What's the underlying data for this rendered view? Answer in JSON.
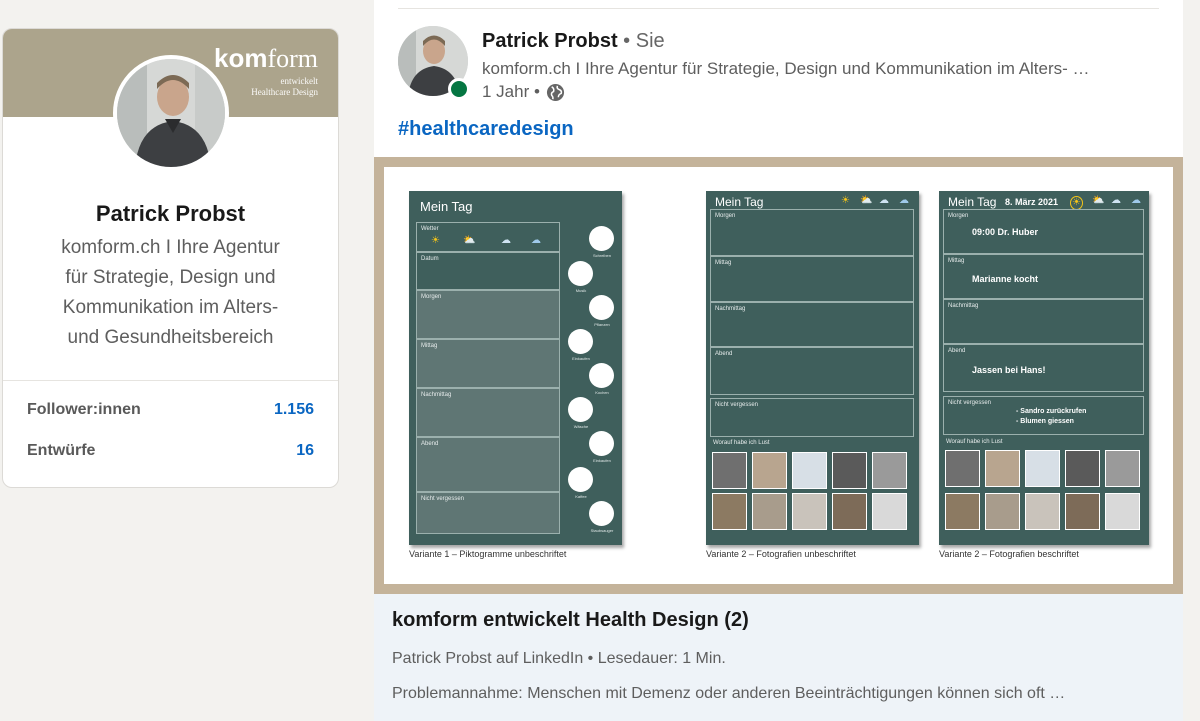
{
  "profile": {
    "banner": {
      "brand_bold": "kom",
      "brand_rest": "form",
      "tagline_1": "entwickelt",
      "tagline_2": "Healthcare Design"
    },
    "name": "Patrick Probst",
    "headline_lines": [
      "komform.ch I Ihre Agentur",
      "für Strategie, Design und",
      "Kommunikation im Alters-",
      "und Gesundheitsbereich"
    ],
    "stats": [
      {
        "label": "Follower:innen",
        "value": "1.156"
      },
      {
        "label": "Entwürfe",
        "value": "16"
      }
    ]
  },
  "post": {
    "author_name": "Patrick Probst",
    "separator": "•",
    "you_label": "Sie",
    "author_headline": "komform.ch I Ihre Agentur für Strategie, Design und Kommunikation im Alters- …",
    "time": "1 Jahr •",
    "hashtag": "#healthcaredesign",
    "media": {
      "board1": {
        "title": "Mein Tag",
        "weather_label": "Wetter",
        "slots": [
          "Datum",
          "Morgen",
          "Mittag",
          "Nachmittag",
          "Abend",
          "Nicht vergessen"
        ],
        "pictograms": [
          "Schreiben",
          "Musik",
          "Pflanzen",
          "Einkaufen",
          "Kochen",
          "Wäsche",
          "Einkaufen",
          "Kaffee",
          "Staubsauger"
        ],
        "caption": "Variante 1 – Piktogramme unbeschriftet"
      },
      "board2": {
        "title": "Mein Tag",
        "slots": [
          "Morgen",
          "Mittag",
          "Nachmittag",
          "Abend",
          "Nicht vergessen",
          "Worauf habe ich Lust"
        ],
        "caption": "Variante 2 – Fotografien unbeschriftet"
      },
      "board3": {
        "title": "Mein Tag",
        "date": "8. März 2021",
        "slots": [
          "Morgen",
          "Mittag",
          "Nachmittag",
          "Abend",
          "Nicht vergessen",
          "Worauf habe ich Lust"
        ],
        "notes": {
          "morgen": "09:00 Dr. Huber",
          "mittag": "Marianne kocht",
          "abend": "Jassen bei Hans!",
          "todo_1": "- Sandro zurückrufen",
          "todo_2": "- Blumen giessen"
        },
        "caption": "Variante 2 – Fotografien beschriftet"
      }
    },
    "article": {
      "title": "komform entwickelt Health Design (2)",
      "source": "Patrick Probst auf LinkedIn • Lesedauer: 1 Min.",
      "excerpt": "Problemannahme: Menschen mit Demenz oder anderen Beeinträchtigungen können sich oft …"
    }
  },
  "colors": {
    "brand_blue": "#0a66c2",
    "banner": "#aca48c",
    "board": "#3f5f5c",
    "presence": "#057642"
  }
}
